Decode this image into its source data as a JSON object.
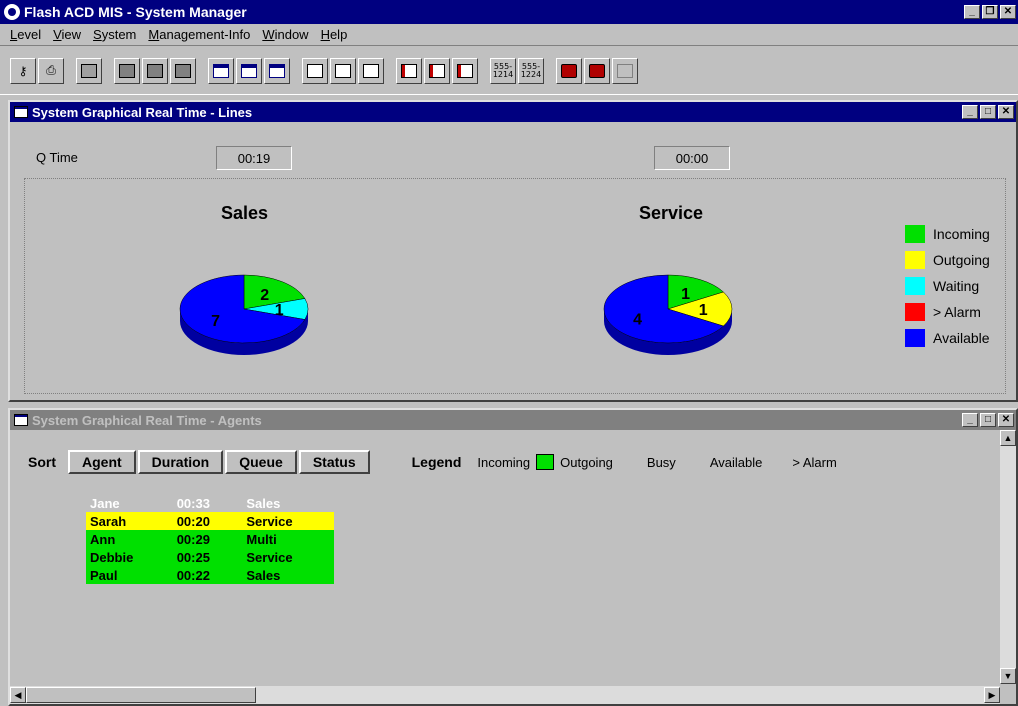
{
  "app": {
    "title": "Flash ACD MIS - System Manager"
  },
  "menu": [
    "Level",
    "View",
    "System",
    "Management-Info",
    "Window",
    "Help"
  ],
  "toolbar": {
    "groups": [
      [
        "key-icon",
        "printer-icon"
      ],
      [
        "chart-tool-icon"
      ],
      [
        "monitor-icon",
        "monitor-icon",
        "monitor-icon"
      ],
      [
        "report-1-icon",
        "report-2-icon",
        "report-3-icon"
      ],
      [
        "report-icon",
        "report-icon",
        "report-icon"
      ],
      [
        "report-red-icon",
        "report-red-icon",
        "report-red-icon"
      ],
      [
        "number-icon",
        "number-icon"
      ],
      [
        "phone-icon",
        "phone-icon",
        "phone-disabled-icon"
      ]
    ],
    "number_labels": [
      "555- 1214",
      "555- 1224"
    ]
  },
  "lines_window": {
    "title": "System Graphical Real Time - Lines",
    "qtime_label": "Q Time",
    "qtime_values": [
      "00:19",
      "00:00"
    ]
  },
  "chart_data": {
    "type": "pie",
    "charts": [
      {
        "title": "Sales",
        "slices": [
          {
            "name": "Incoming",
            "value": 2
          },
          {
            "name": "Waiting",
            "value": 1
          },
          {
            "name": "Available",
            "value": 7
          }
        ]
      },
      {
        "title": "Service",
        "slices": [
          {
            "name": "Incoming",
            "value": 1
          },
          {
            "name": "Outgoing",
            "value": 1
          },
          {
            "name": "Available",
            "value": 4
          }
        ]
      }
    ],
    "legend": [
      {
        "label": "Incoming",
        "color": "#00e000"
      },
      {
        "label": "Outgoing",
        "color": "#ffff00"
      },
      {
        "label": "Waiting",
        "color": "#00ffff"
      },
      {
        "label": "> Alarm",
        "color": "#ff0000"
      },
      {
        "label": "Available",
        "color": "#0000ff"
      }
    ],
    "legend_position": "right"
  },
  "agents_window": {
    "title": "System Graphical Real Time - Agents",
    "sort_label": "Sort",
    "sort_buttons": [
      "Agent",
      "Duration",
      "Queue",
      "Status"
    ],
    "legend_label": "Legend",
    "legend_items": [
      "Incoming",
      "Outgoing",
      "Busy",
      "Available",
      "> Alarm"
    ],
    "agents": [
      {
        "name": "Jane",
        "duration": "00:33",
        "queue": "Sales",
        "state": "available"
      },
      {
        "name": "Sarah",
        "duration": "00:20",
        "queue": "Service",
        "state": "outgoing"
      },
      {
        "name": "Ann",
        "duration": "00:29",
        "queue": "Multi",
        "state": "incoming"
      },
      {
        "name": "Debbie",
        "duration": "00:25",
        "queue": "Service",
        "state": "incoming"
      },
      {
        "name": "Paul",
        "duration": "00:22",
        "queue": "Sales",
        "state": "incoming"
      }
    ]
  }
}
